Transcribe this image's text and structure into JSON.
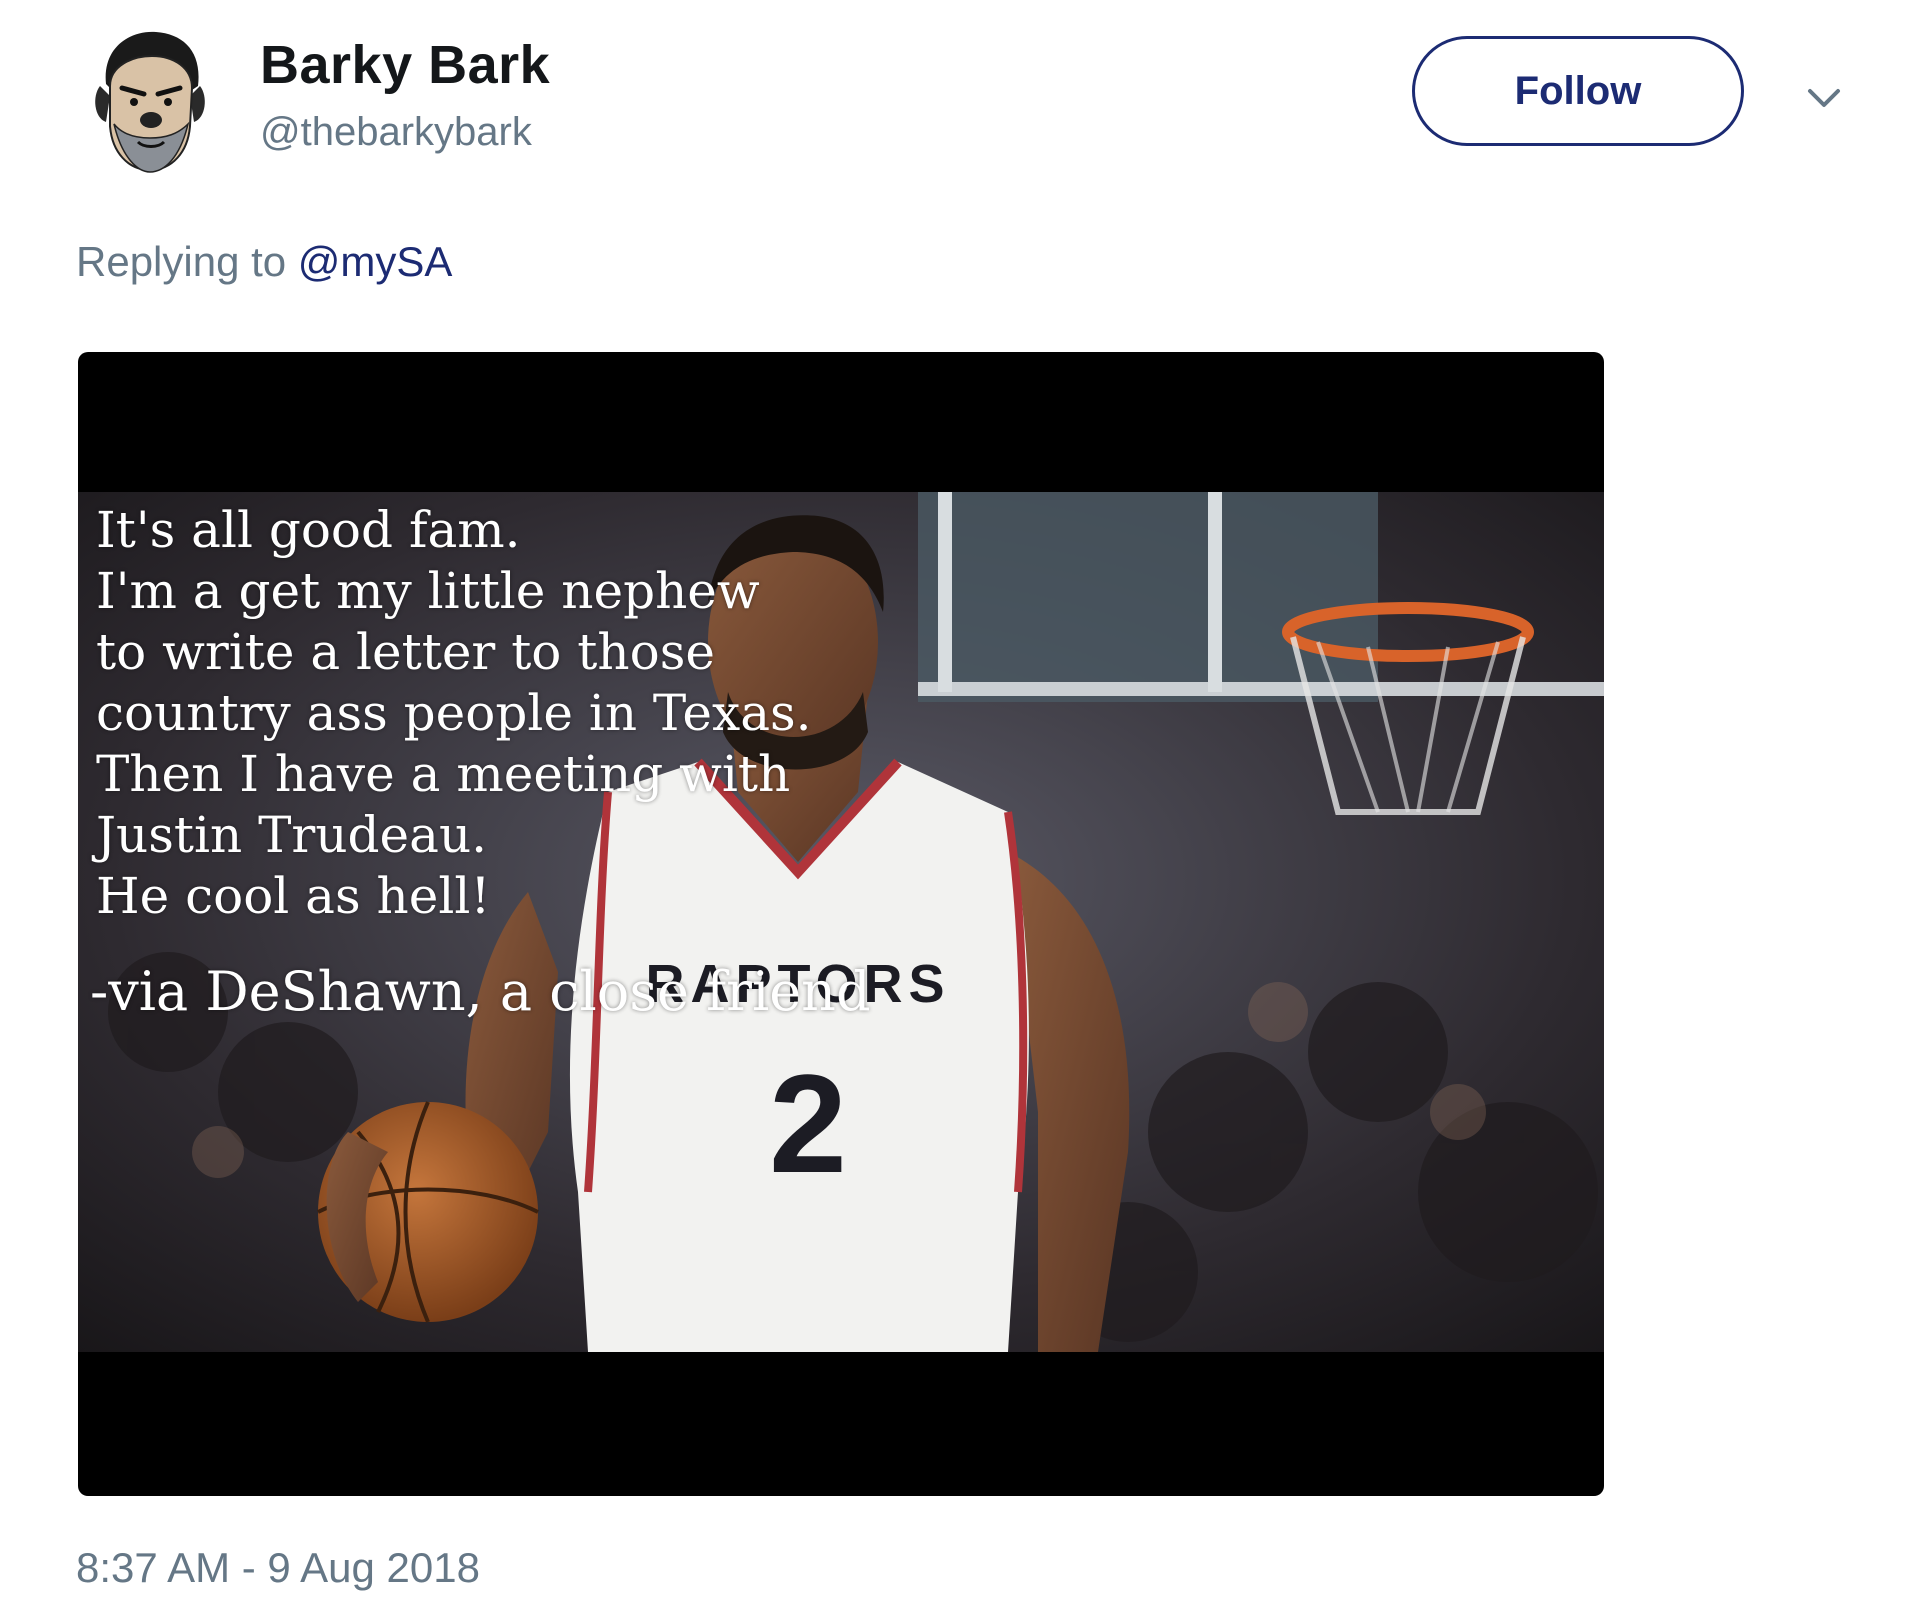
{
  "user": {
    "display_name": "Barky Bark",
    "handle": "@thebarkybark",
    "avatar_icon": "cartoon-dog-avatar-icon"
  },
  "actions": {
    "follow_label": "Follow",
    "menu_icon": "chevron-down-icon"
  },
  "reply": {
    "prefix": "Replying to",
    "mention": "@mySA"
  },
  "media": {
    "overlay_lines": [
      "It's all good fam.",
      "I'm a get my little nephew",
      "to write a letter to those",
      "country ass people in Texas.",
      "Then I have a meeting with",
      "Justin Trudeau.",
      "He cool as hell!"
    ],
    "attribution": "-via DeShawn, a close friend",
    "jersey_text": "RAPTORS",
    "jersey_number": "2"
  },
  "timestamp": "8:37 AM - 9 Aug 2018",
  "colors": {
    "accent": "#1c2b73",
    "muted": "#657786",
    "text": "#14171a"
  }
}
